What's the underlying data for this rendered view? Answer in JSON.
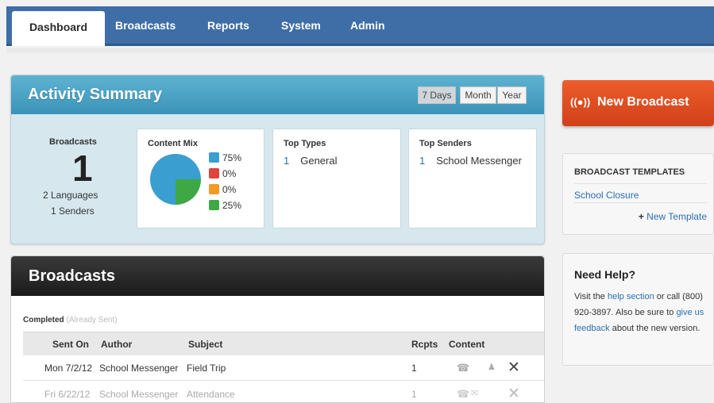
{
  "nav": {
    "tabs": [
      "Dashboard",
      "Broadcasts",
      "Reports",
      "System",
      "Admin"
    ],
    "active": "Dashboard"
  },
  "activity": {
    "title": "Activity Summary",
    "ranges": [
      "7 Days",
      "Month",
      "Year"
    ],
    "selected_range": "7 Days",
    "broadcasts_label": "Broadcasts",
    "broadcasts_count": "1",
    "languages": "2 Languages",
    "senders": "1 Senders",
    "content_mix": {
      "title": "Content Mix",
      "items": [
        {
          "icon": "phone-icon",
          "value": "75%",
          "color": "#3b9ed0"
        },
        {
          "icon": "email-icon",
          "value": "0%",
          "color": "#e0443a"
        },
        {
          "icon": "sms-icon",
          "value": "0%",
          "color": "#f19a24"
        },
        {
          "icon": "person-icon",
          "value": "25%",
          "color": "#3ea844"
        }
      ]
    },
    "top_types": {
      "title": "Top Types",
      "rows": [
        {
          "num": "1",
          "label": "General"
        }
      ]
    },
    "top_senders": {
      "title": "Top Senders",
      "rows": [
        {
          "num": "1",
          "label": "School Messenger"
        }
      ]
    }
  },
  "broadcasts": {
    "title": "Broadcasts",
    "section_label": "Completed",
    "section_sub": "(Already Sent)",
    "columns": [
      "Sent On",
      "Author",
      "Subject",
      "Rcpts",
      "Content"
    ],
    "rows": [
      {
        "sent_on": "Mon 7/2/12",
        "author": "School Messenger",
        "subject": "Field Trip",
        "rcpts": "1"
      },
      {
        "sent_on": "Fri 6/22/12",
        "author": "School Messenger",
        "subject": "Attendance",
        "rcpts": "1"
      }
    ]
  },
  "sidebar": {
    "new_broadcast": "New Broadcast",
    "templates_title": "BROADCAST TEMPLATES",
    "template_item": "School Closure",
    "new_template": "New Template",
    "help_title": "Need Help?",
    "help": {
      "t1": "Visit the ",
      "link1": "help section",
      "t2": " or call (800) 920-3897. Also be sure to ",
      "link2": "give us feedback",
      "t3": " about the new version."
    }
  }
}
